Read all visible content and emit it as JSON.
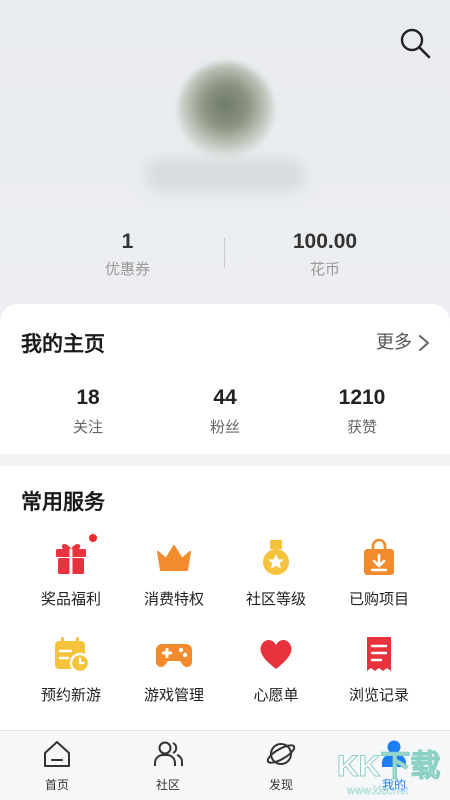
{
  "header": {
    "stats": [
      {
        "value": "1",
        "label": "优惠券"
      },
      {
        "value": "100.00",
        "label": "花币"
      }
    ]
  },
  "homepage": {
    "title": "我的主页",
    "more_label": "更多",
    "stats": [
      {
        "value": "18",
        "label": "关注"
      },
      {
        "value": "44",
        "label": "粉丝"
      },
      {
        "value": "1210",
        "label": "获赞"
      }
    ]
  },
  "services": {
    "title": "常用服务",
    "items": [
      {
        "label": "奖品福利",
        "icon": "gift-icon",
        "badge": true
      },
      {
        "label": "消费特权",
        "icon": "crown-icon"
      },
      {
        "label": "社区等级",
        "icon": "medal-icon"
      },
      {
        "label": "已购项目",
        "icon": "shopping-bag-icon"
      },
      {
        "label": "预约新游",
        "icon": "calendar-clock-icon"
      },
      {
        "label": "游戏管理",
        "icon": "gamepad-icon"
      },
      {
        "label": "心愿单",
        "icon": "heart-icon"
      },
      {
        "label": "浏览记录",
        "icon": "receipt-icon"
      }
    ]
  },
  "bottom_nav": {
    "items": [
      {
        "label": "首页",
        "icon": "home-icon"
      },
      {
        "label": "社区",
        "icon": "community-icon"
      },
      {
        "label": "发现",
        "icon": "planet-icon"
      },
      {
        "label": "我的",
        "icon": "profile-icon",
        "active": true
      }
    ]
  },
  "watermark": {
    "brand": "KK下载",
    "url": "www.kkx.net"
  },
  "colors": {
    "accent": "#1d7df2",
    "red": "#e8323d",
    "orange": "#f28a2e",
    "yellow": "#f4c33b",
    "badge": "#ee2a2a"
  }
}
